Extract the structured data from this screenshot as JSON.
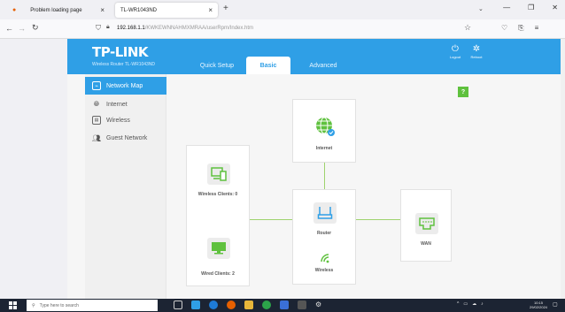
{
  "browser": {
    "tabs": [
      {
        "label": "Problem loading page"
      },
      {
        "label": "TL-WR1043ND"
      }
    ],
    "new_tab": "+",
    "address": {
      "host": "192.168.1.1",
      "path": "/KWKEWNNAHMXMRAA/userRpm/Index.htm"
    }
  },
  "router": {
    "brand": "TP-LINK",
    "model": "Wireless Router TL-WR1043ND",
    "tabs": [
      {
        "label": "Quick Setup"
      },
      {
        "label": "Basic"
      },
      {
        "label": "Advanced"
      }
    ],
    "logout": "Logout",
    "reboot": "Reboot",
    "sidebar": [
      {
        "label": "Network Map",
        "icon": "network-map-icon"
      },
      {
        "label": "Internet",
        "icon": "globe-icon"
      },
      {
        "label": "Wireless",
        "icon": "wireless-icon"
      },
      {
        "label": "Guest Network",
        "icon": "guest-icon"
      }
    ],
    "help": "?",
    "map": {
      "internet": "Internet",
      "wireless_clients": "Wireless Clients: 0",
      "wired_clients": "Wired Clients: 2",
      "router": "Router",
      "wireless": "Wireless",
      "wan": "WAN"
    }
  },
  "taskbar": {
    "search_placeholder": "Type here to search",
    "time": "10:15",
    "date": "29/02/2024"
  },
  "colors": {
    "accent": "#2f9fe6",
    "online": "#5fc13e",
    "link_line": "#9fd36e"
  }
}
